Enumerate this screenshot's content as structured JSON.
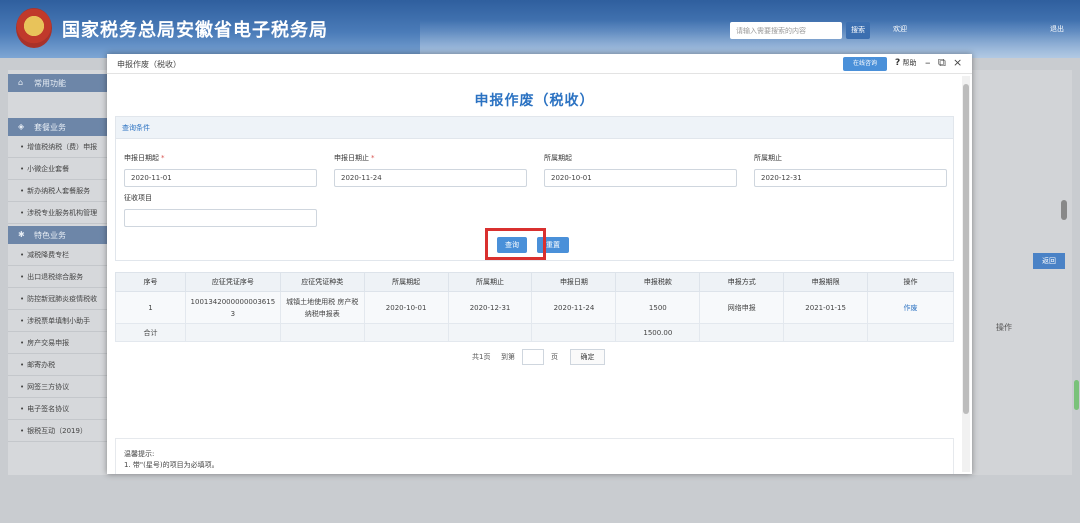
{
  "site": {
    "title": "国家税务总局安徽省电子税务局",
    "search_placeholder": "请输入需要搜索的内容",
    "search_label": "搜索",
    "welcome": "欢迎",
    "exit": "退出"
  },
  "sidebar": {
    "sections": [
      {
        "label": "常用功能",
        "icon": "home-icon"
      },
      {
        "label": "套餐业务",
        "icon": "layers-icon"
      }
    ],
    "items_a": [
      "增值税纳税（费）申报",
      "小微企业套餐",
      "新办纳税人套餐服务",
      "涉税专业服务机构管理"
    ],
    "special_label": "特色业务",
    "items_b": [
      "减税降费专栏",
      "出口退税综合服务",
      "防控新冠肺炎疫情税收",
      "涉税票单填制小助手",
      "房产交易申报",
      "邮寄办税",
      "网签三方协议",
      "电子签名协议",
      "银税互动（2019）"
    ]
  },
  "right_panel": {
    "button_label": "返回",
    "op_label": "操作"
  },
  "modal": {
    "window_title": "申报作废（税收）",
    "online_label": "在线咨询",
    "help_label": "帮助",
    "heading": "申报作废（税收）",
    "query_section_title": "查询条件",
    "fields": [
      {
        "label": "申报日期起",
        "required": "*",
        "value": "2020-11-01"
      },
      {
        "label": "申报日期止",
        "required": "*",
        "value": "2020-11-24"
      },
      {
        "label": "所属期起",
        "required": "",
        "value": "2020-10-01"
      },
      {
        "label": "所属期止",
        "required": "",
        "value": "2020-12-31"
      },
      {
        "label": "征收项目",
        "required": "",
        "value": ""
      }
    ],
    "query_button": "查询",
    "reset_button": "重置"
  },
  "table": {
    "headers": [
      "序号",
      "应征凭证序号",
      "应征凭证种类",
      "所属期起",
      "所属期止",
      "申报日期",
      "申报税款",
      "申报方式",
      "申报期限",
      "操作"
    ],
    "rows": [
      {
        "index": "1",
        "voucher_no": "10013420000000036153",
        "voucher_type": "城镇土地使用税 房产税纳税申报表",
        "period_start": "2020-10-01",
        "period_end": "2020-12-31",
        "declare_date": "2020-11-24",
        "tax": "1500",
        "method": "网络申报",
        "deadline": "2021-01-15",
        "action": "作废"
      }
    ],
    "total_label": "合计",
    "total_tax": "1500.00"
  },
  "pager": {
    "total": "共1页",
    "goto": "到第",
    "page_unit": "页",
    "confirm": "确定"
  },
  "tips": {
    "title": "温馨提示:",
    "line1": "1. 带\"(星号)的项目为必填项。"
  }
}
